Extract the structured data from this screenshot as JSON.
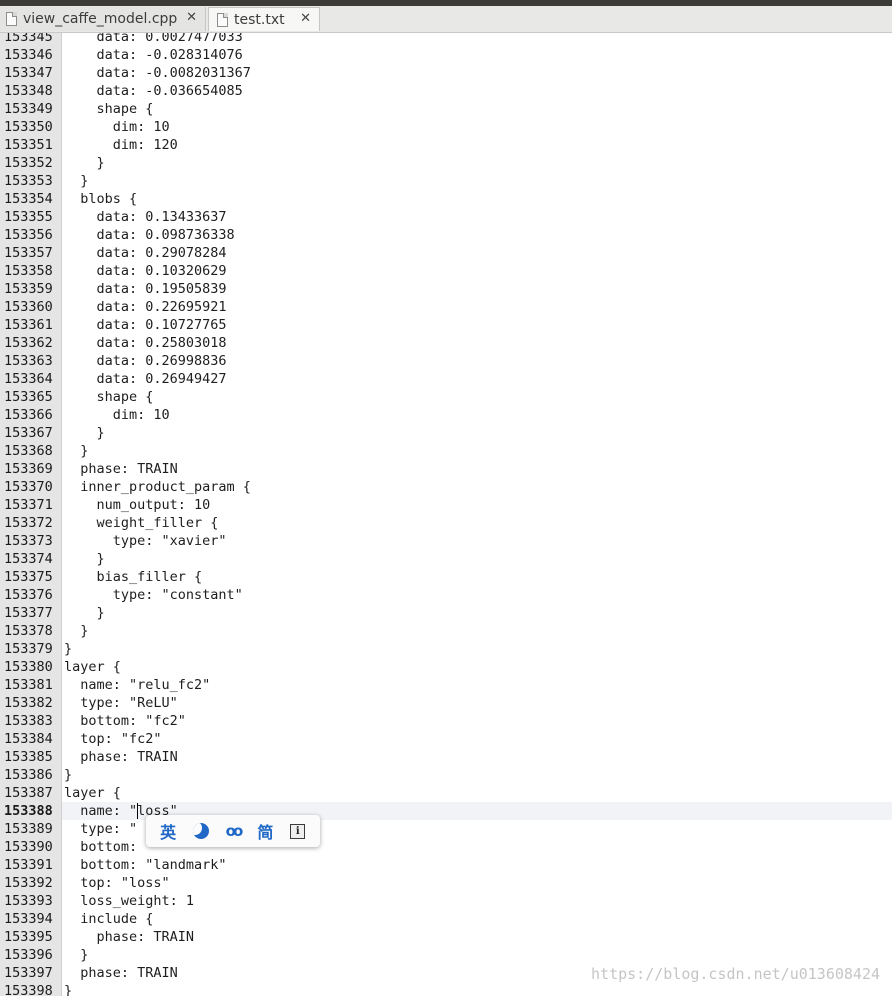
{
  "window": {
    "tabs": [
      {
        "label": "view_caffe_model.cpp",
        "active": false
      },
      {
        "label": "test.txt",
        "active": true
      }
    ],
    "close_glyph": "✕"
  },
  "editor": {
    "current_line": "153388",
    "lines": [
      {
        "n": "153345",
        "t": "    data: 0.0027477033"
      },
      {
        "n": "153346",
        "t": "    data: -0.028314076"
      },
      {
        "n": "153347",
        "t": "    data: -0.0082031367"
      },
      {
        "n": "153348",
        "t": "    data: -0.036654085"
      },
      {
        "n": "153349",
        "t": "    shape {"
      },
      {
        "n": "153350",
        "t": "      dim: 10"
      },
      {
        "n": "153351",
        "t": "      dim: 120"
      },
      {
        "n": "153352",
        "t": "    }"
      },
      {
        "n": "153353",
        "t": "  }"
      },
      {
        "n": "153354",
        "t": "  blobs {"
      },
      {
        "n": "153355",
        "t": "    data: 0.13433637"
      },
      {
        "n": "153356",
        "t": "    data: 0.098736338"
      },
      {
        "n": "153357",
        "t": "    data: 0.29078284"
      },
      {
        "n": "153358",
        "t": "    data: 0.10320629"
      },
      {
        "n": "153359",
        "t": "    data: 0.19505839"
      },
      {
        "n": "153360",
        "t": "    data: 0.22695921"
      },
      {
        "n": "153361",
        "t": "    data: 0.10727765"
      },
      {
        "n": "153362",
        "t": "    data: 0.25803018"
      },
      {
        "n": "153363",
        "t": "    data: 0.26998836"
      },
      {
        "n": "153364",
        "t": "    data: 0.26949427"
      },
      {
        "n": "153365",
        "t": "    shape {"
      },
      {
        "n": "153366",
        "t": "      dim: 10"
      },
      {
        "n": "153367",
        "t": "    }"
      },
      {
        "n": "153368",
        "t": "  }"
      },
      {
        "n": "153369",
        "t": "  phase: TRAIN"
      },
      {
        "n": "153370",
        "t": "  inner_product_param {"
      },
      {
        "n": "153371",
        "t": "    num_output: 10"
      },
      {
        "n": "153372",
        "t": "    weight_filler {"
      },
      {
        "n": "153373",
        "t": "      type: \"xavier\""
      },
      {
        "n": "153374",
        "t": "    }"
      },
      {
        "n": "153375",
        "t": "    bias_filler {"
      },
      {
        "n": "153376",
        "t": "      type: \"constant\""
      },
      {
        "n": "153377",
        "t": "    }"
      },
      {
        "n": "153378",
        "t": "  }"
      },
      {
        "n": "153379",
        "t": "}"
      },
      {
        "n": "153380",
        "t": "layer {"
      },
      {
        "n": "153381",
        "t": "  name: \"relu_fc2\""
      },
      {
        "n": "153382",
        "t": "  type: \"ReLU\""
      },
      {
        "n": "153383",
        "t": "  bottom: \"fc2\""
      },
      {
        "n": "153384",
        "t": "  top: \"fc2\""
      },
      {
        "n": "153385",
        "t": "  phase: TRAIN"
      },
      {
        "n": "153386",
        "t": "}"
      },
      {
        "n": "153387",
        "t": "layer {"
      },
      {
        "n": "153388",
        "t": "  name: \"loss\""
      },
      {
        "n": "153389",
        "t": "  type: \""
      },
      {
        "n": "153390",
        "t": "  bottom: \""
      },
      {
        "n": "153391",
        "t": "  bottom: \"landmark\""
      },
      {
        "n": "153392",
        "t": "  top: \"loss\""
      },
      {
        "n": "153393",
        "t": "  loss_weight: 1"
      },
      {
        "n": "153394",
        "t": "  include {"
      },
      {
        "n": "153395",
        "t": "    phase: TRAIN"
      },
      {
        "n": "153396",
        "t": "  }"
      },
      {
        "n": "153397",
        "t": "  phase: TRAIN"
      },
      {
        "n": "153398",
        "t": "}"
      }
    ]
  },
  "ime_toolbar": {
    "lang_label": "英",
    "moon_icon": "half-width-moon-icon",
    "punct_icon": "punctuation-icon",
    "punct_glyph": "oo",
    "script_label": "简",
    "info_label": "i"
  },
  "watermark": "https://blog.csdn.net/u013608424",
  "colors": {
    "tab_bar": "#e8e8e7",
    "gutter": "#e5e5e5",
    "ime_accent": "#1f68c7",
    "current_line_highlight": "#f1f3f6"
  }
}
